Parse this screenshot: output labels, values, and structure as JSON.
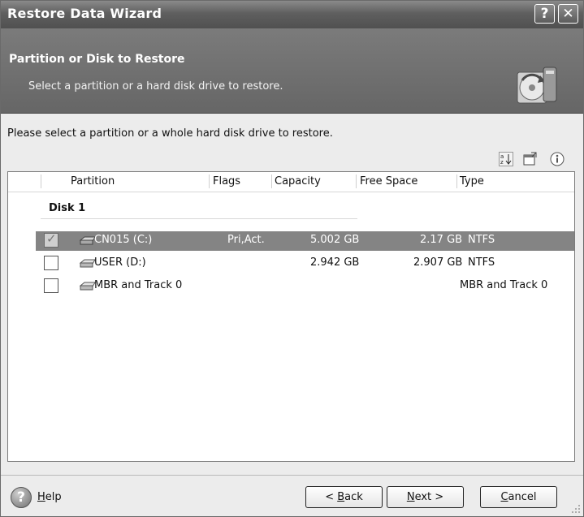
{
  "window": {
    "title": "Restore Data Wizard",
    "help_btn": "?",
    "close_btn": "✕"
  },
  "header": {
    "title": "Partition or Disk to Restore",
    "subtitle": "Select a partition or a hard disk drive to restore."
  },
  "instruction": "Please select a partition or a whole hard disk drive to restore.",
  "columns": [
    "Partition",
    "Flags",
    "Capacity",
    "Free Space",
    "Type"
  ],
  "disk": {
    "label": "Disk 1"
  },
  "rows": [
    {
      "partition": "CN015 (C:)",
      "flags": "Pri,Act.",
      "capacity": "5.002 GB",
      "free_space": "2.17 GB",
      "type": "NTFS",
      "checked": true,
      "selected": true
    },
    {
      "partition": "USER (D:)",
      "flags": "",
      "capacity": "2.942 GB",
      "free_space": "2.907 GB",
      "type": "NTFS",
      "checked": false,
      "selected": false
    },
    {
      "partition": "MBR and Track 0",
      "flags": "",
      "capacity": "",
      "free_space": "",
      "type": "MBR and Track 0",
      "checked": false,
      "selected": false
    }
  ],
  "buttons": {
    "help_prefix": "H",
    "help_rest": "elp",
    "back_prefix": "< ",
    "back_u": "B",
    "back_rest": "ack",
    "next_u": "N",
    "next_rest": "ext >",
    "cancel_u": "C",
    "cancel_rest": "ancel"
  },
  "icons": {
    "help": "?",
    "checkmark": "✓"
  }
}
